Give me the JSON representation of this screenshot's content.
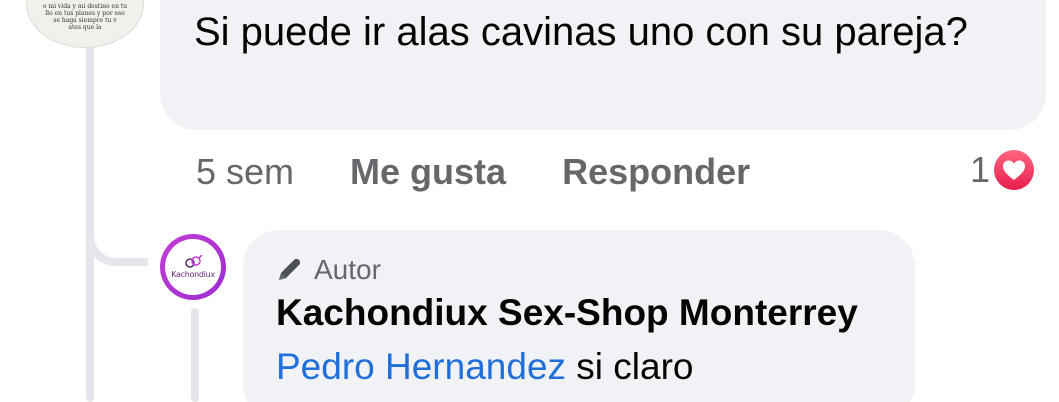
{
  "comment": {
    "avatar_lines": [
      "o mi vida y mi destino en tu",
      "llo en tus planes y por eso",
      "se haga siempre tu v",
      "ates que la"
    ],
    "text": "Si puede ir alas cavinas uno con su pareja?",
    "time": "5 sem",
    "like_label": "Me gusta",
    "reply_label": "Responder",
    "reaction_count": "1",
    "reaction_icon": "heart-icon",
    "reaction_color": "#e61e4d"
  },
  "reply": {
    "avatar_logo_text": "Kachondiux",
    "author_badge_label": "Autor",
    "author_badge_icon": "pencil-icon",
    "author_name": "Kachondiux Sex-Shop Monterrey",
    "mention": "Pedro Hernandez",
    "text": " si claro",
    "mention_color": "#216fdb"
  },
  "colors": {
    "bubble": "#f0f2f5",
    "meta_text": "#65676b",
    "body_text": "#050505",
    "avatar_ring": "#c43bd6"
  }
}
